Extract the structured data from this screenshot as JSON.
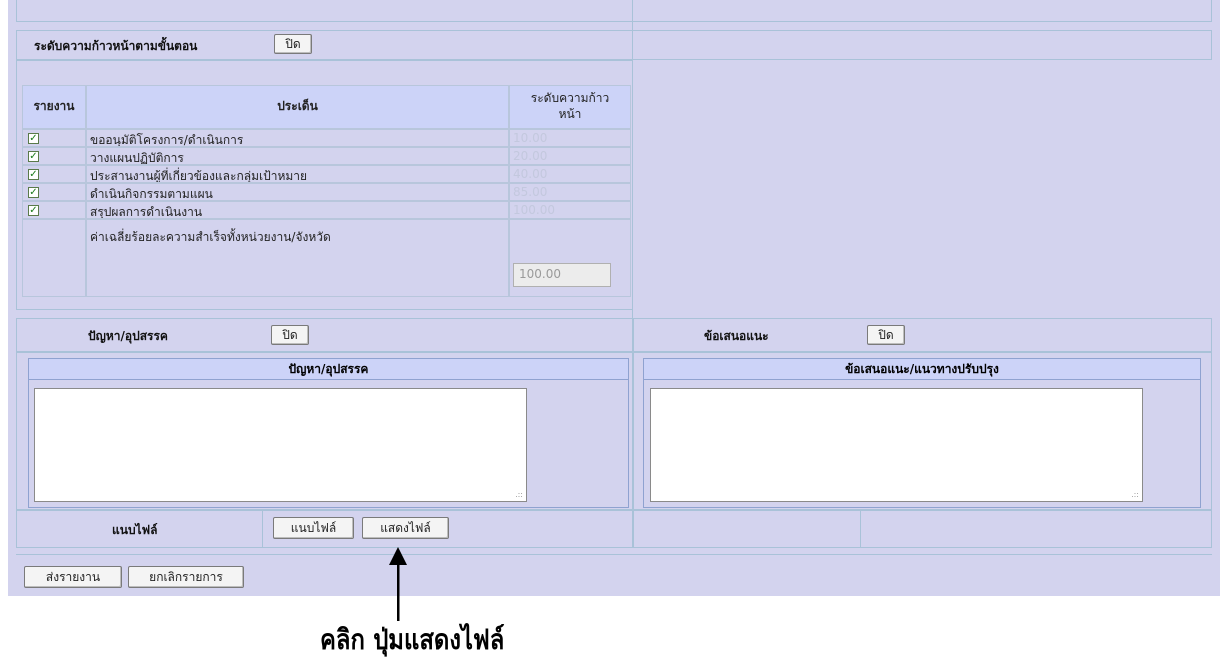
{
  "progress": {
    "title": "ระดับความก้าวหน้าตามขั้นตอน",
    "close_label": "ปิด",
    "columns": [
      "รายงาน",
      "ประเด็น",
      "ระดับความก้าวหน้า"
    ],
    "rows": [
      {
        "checked": true,
        "issue": "ขออนุมัติโครงการ/ดำเนินการ",
        "level": "10.00"
      },
      {
        "checked": true,
        "issue": "วางแผนปฏิบัติการ",
        "level": "20.00"
      },
      {
        "checked": true,
        "issue": "ประสานงานผู้ที่เกี่ยวข้องและกลุ่มเป้าหมาย",
        "level": "40.00"
      },
      {
        "checked": true,
        "issue": "ดำเนินกิจกรรมตามแผน",
        "level": "85.00"
      },
      {
        "checked": true,
        "issue": "สรุปผลการดำเนินงาน",
        "level": "100.00"
      }
    ],
    "average_label": "ค่าเฉลี่ยร้อยละความสำเร็จทั้งหน่วยงาน/จังหวัด",
    "average_value": "100.00"
  },
  "problems": {
    "title": "ปัญหา/อุปสรรค",
    "close_label": "ปิด",
    "header": "ปัญหา/อุปสรรค",
    "value": ""
  },
  "suggestions": {
    "title": "ข้อเสนอแนะ",
    "close_label": "ปิด",
    "header": "ข้อเสนอแนะ/แนวทางปรับปรุง",
    "value": ""
  },
  "attach": {
    "title": "แนบไฟล์",
    "attach_label": "แนบไฟล์",
    "show_label": "แสดงไฟล์"
  },
  "footer": {
    "submit_label": "ส่งรายงาน",
    "cancel_label": "ยกเลิกรายการ"
  },
  "annotation": {
    "text": "คลิก ปุ่มแสดงไฟล์"
  }
}
